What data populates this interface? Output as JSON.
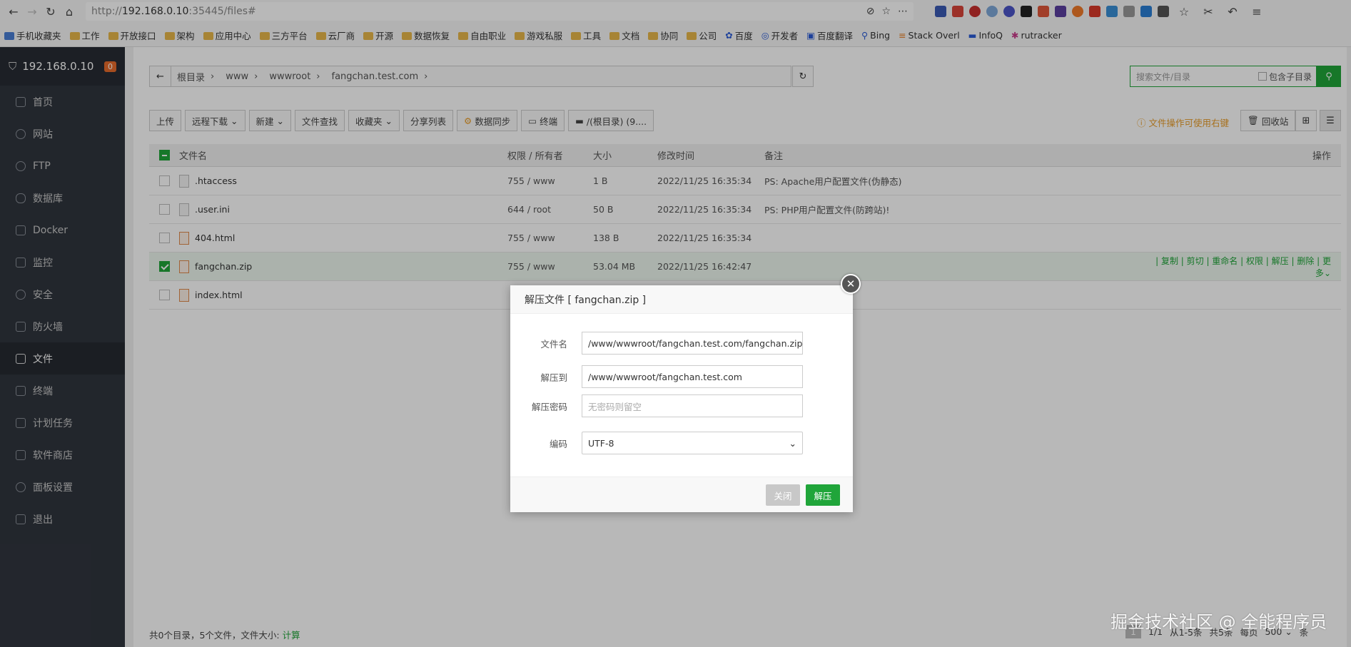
{
  "browser": {
    "url_prefix": "http://",
    "url_host": "192.168.0.10",
    "url_rest": ":35445/files#",
    "bookmarks": [
      "手机收藏夹",
      "工作",
      "开放接口",
      "架构",
      "应用中心",
      "三方平台",
      "云厂商",
      "开源",
      "数据恢复",
      "自由职业",
      "游戏私服",
      "工具",
      "文档",
      "协同",
      "公司",
      "百度",
      "开发者",
      "百度翻译",
      "Bing",
      "Stack Overl",
      "InfoQ",
      "rutracker"
    ]
  },
  "sidebar": {
    "host": "192.168.0.10",
    "badge": "0",
    "items": [
      "首页",
      "网站",
      "FTP",
      "数据库",
      "Docker",
      "监控",
      "安全",
      "防火墙",
      "文件",
      "终端",
      "计划任务",
      "软件商店",
      "面板设置",
      "退出"
    ],
    "active": "文件"
  },
  "breadcrumb": [
    "根目录",
    "www",
    "wwwroot",
    "fangchan.test.com"
  ],
  "search": {
    "placeholder": "搜索文件/目录",
    "include_sub": "包含子目录"
  },
  "toolbar": {
    "buttons": [
      "上传",
      "远程下载",
      "新建",
      "文件查找",
      "收藏夹",
      "分享列表",
      "数据同步",
      "终端",
      "/(根目录) (9...."
    ],
    "tip": "文件操作可使用右键",
    "recycle": "回收站"
  },
  "table": {
    "headers": {
      "name": "文件名",
      "perm": "权限 / 所有者",
      "size": "大小",
      "time": "修改时间",
      "note": "备注",
      "op": "操作"
    },
    "rows": [
      {
        "name": ".htaccess",
        "perm": "755 / www",
        "size": "1 B",
        "time": "2022/11/25 16:35:34",
        "note": "PS: Apache用户配置文件(伪静态)"
      },
      {
        "name": ".user.ini",
        "perm": "644 / root",
        "size": "50 B",
        "time": "2022/11/25 16:35:34",
        "note": "PS: PHP用户配置文件(防跨站)!"
      },
      {
        "name": "404.html",
        "perm": "755 / www",
        "size": "138 B",
        "time": "2022/11/25 16:35:34",
        "note": ""
      },
      {
        "name": "fangchan.zip",
        "perm": "755 / www",
        "size": "53.04 MB",
        "time": "2022/11/25 16:42:47",
        "note": "",
        "ops": "| 复制 | 剪切 | 重命名 | 权限 | 解压 | 删除 | 更多"
      },
      {
        "name": "index.html",
        "perm": "",
        "size": "",
        "time": "",
        "note": ""
      }
    ]
  },
  "status": {
    "summary": "共0个目录，5个文件，文件大小:",
    "calc": "计算"
  },
  "pager": {
    "current": "1",
    "pages": "1/1",
    "range": "从1-5条",
    "total": "共5条",
    "per_page_label": "每页",
    "per_page": "500",
    "unit": "条"
  },
  "watermark": "掘金技术社区 @ 全能程序员",
  "modal": {
    "title": "解压文件 [ fangchan.zip ]",
    "filename_label": "文件名",
    "filename_value": "/www/wwwroot/fangchan.test.com/fangchan.zip",
    "extract_label": "解压到",
    "extract_value": "/www/wwwroot/fangchan.test.com",
    "password_label": "解压密码",
    "password_placeholder": "无密码则留空",
    "encoding_label": "编码",
    "encoding_value": "UTF-8",
    "close_btn": "关闭",
    "extract_btn": "解压"
  },
  "colors": {
    "accent": "#20a53a",
    "sidebar_bg": "#30353e",
    "warn": "#e89c28"
  }
}
